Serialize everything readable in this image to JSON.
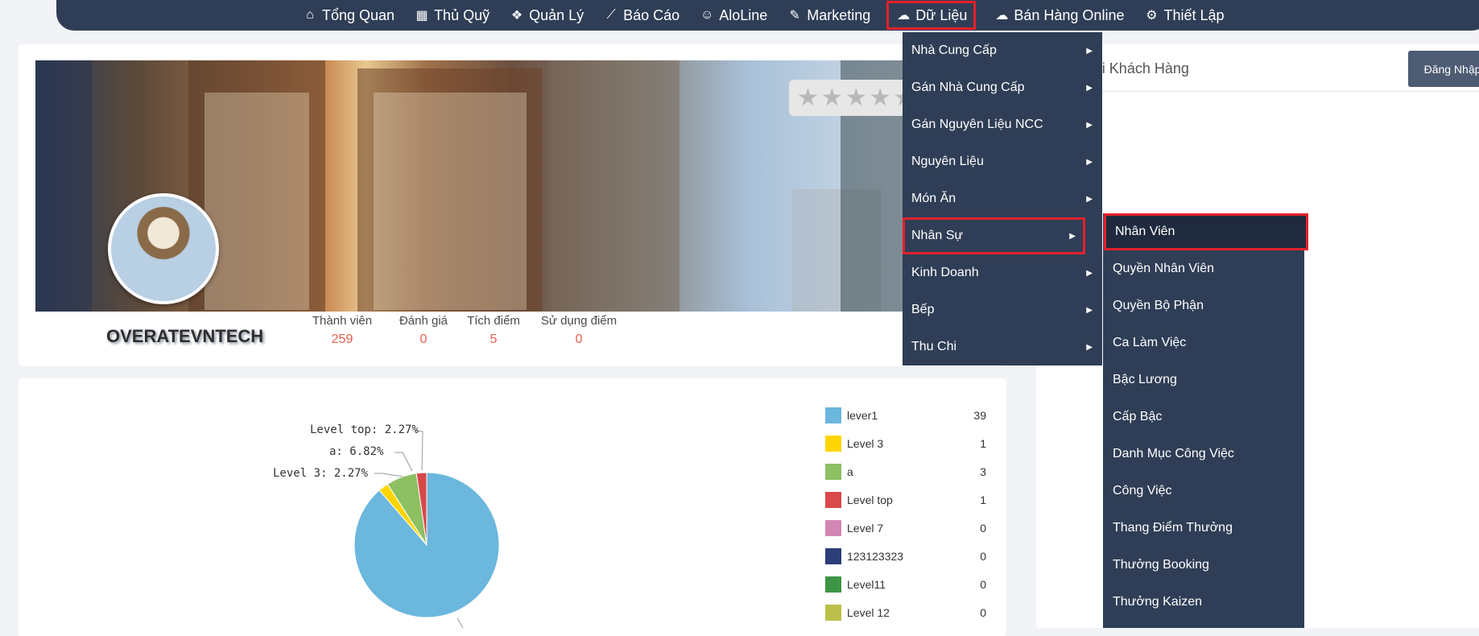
{
  "nav": {
    "items": [
      {
        "label": "Tổng Quan",
        "icon": "home-icon"
      },
      {
        "label": "Thủ Quỹ",
        "icon": "calculator-icon"
      },
      {
        "label": "Quản Lý",
        "icon": "cubes-icon"
      },
      {
        "label": "Báo Cáo",
        "icon": "line-chart-icon"
      },
      {
        "label": "AloLine",
        "icon": "users-icon"
      },
      {
        "label": "Marketing",
        "icon": "paint-brush-icon"
      },
      {
        "label": "Dữ Liệu",
        "icon": "cloud-upload-icon"
      },
      {
        "label": "Bán Hàng Online",
        "icon": "cloud-icon"
      },
      {
        "label": "Thiết Lập",
        "icon": "gear-icon"
      }
    ]
  },
  "profile": {
    "username": "OVERATEVNTECH",
    "stats": [
      {
        "label": "Thành viên",
        "value": "259"
      },
      {
        "label": "Đánh giá",
        "value": "0"
      },
      {
        "label": "Tích điểm",
        "value": "5"
      },
      {
        "label": "Sử dụng điểm",
        "value": "0"
      }
    ],
    "rating_stars": 0
  },
  "right_panel": {
    "title": "Tổng Đài Chăm Sóc Khách Hàng",
    "visible_title": "ời Khách Hàng",
    "login_label": "Đăng Nhập"
  },
  "dropdown": {
    "items": [
      {
        "label": "Nhà Cung Cấp"
      },
      {
        "label": "Gán Nhà Cung Cấp"
      },
      {
        "label": "Gán Nguyên Liệu NCC"
      },
      {
        "label": "Nguyên Liệu"
      },
      {
        "label": "Món Ăn"
      },
      {
        "label": "Nhân Sự"
      },
      {
        "label": "Kinh Doanh"
      },
      {
        "label": "Bếp"
      },
      {
        "label": "Thu Chi"
      }
    ],
    "submenu": [
      {
        "label": "Nhân Viên"
      },
      {
        "label": "Quyền Nhân Viên"
      },
      {
        "label": "Quyền Bộ Phận"
      },
      {
        "label": "Ca Làm Việc"
      },
      {
        "label": "Bậc Lương"
      },
      {
        "label": "Cấp Bậc"
      },
      {
        "label": "Danh Mục Công Việc"
      },
      {
        "label": "Công Việc"
      },
      {
        "label": "Thang Điểm Thưởng"
      },
      {
        "label": "Thưởng Booking"
      },
      {
        "label": "Thưởng Kaizen"
      }
    ]
  },
  "chart_data": {
    "type": "pie",
    "categories": [
      "lever1",
      "Level 3",
      "a",
      "Level top",
      "Level 7",
      "123123323",
      "Level11",
      "Level 12"
    ],
    "values": [
      39,
      1,
      3,
      1,
      0,
      0,
      0,
      0
    ],
    "colors": [
      "#6bb7dd",
      "#ffd500",
      "#8dbf63",
      "#d9484a",
      "#d286b4",
      "#2c3e78",
      "#3d9444",
      "#bcc04a"
    ],
    "slice_labels": [
      {
        "text": "Level top: 2.27%"
      },
      {
        "text": "a: 6.82%"
      },
      {
        "text": "Level 3: 2.27%"
      }
    ],
    "legend_position": "right"
  },
  "colors": {
    "navbar": "#2f3e56",
    "highlight": "#e4202a",
    "stat_value": "#e85e4d"
  }
}
